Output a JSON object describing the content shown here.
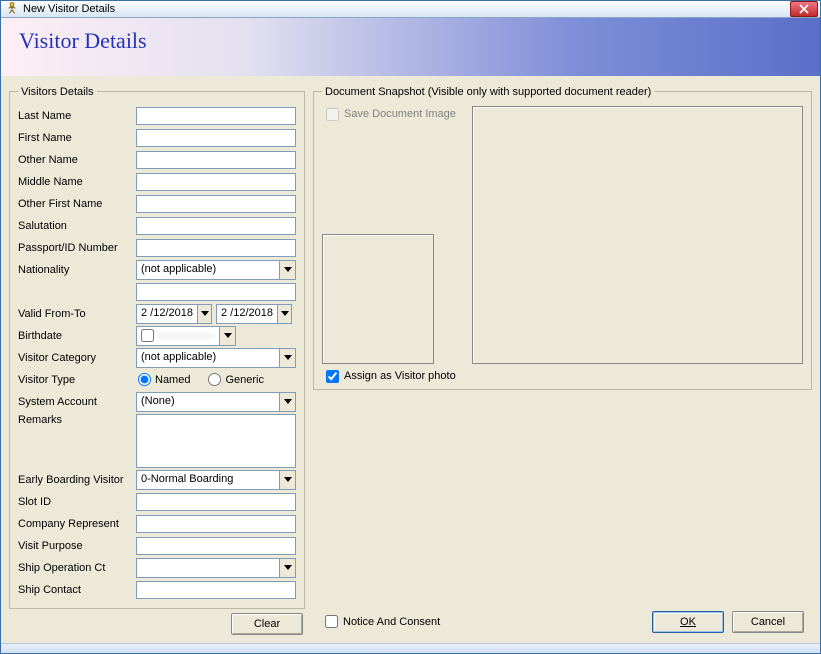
{
  "window": {
    "title": "New Visitor Details"
  },
  "header": {
    "title": "Visitor Details"
  },
  "visitorsDetails": {
    "legend": "Visitors Details",
    "labels": {
      "lastName": "Last Name",
      "firstName": "First Name",
      "otherName": "Other Name",
      "middleName": "Middle Name",
      "otherFirstName": "Other First Name",
      "salutation": "Salutation",
      "passportId": "Passport/ID Number",
      "nationality": "Nationality",
      "validFromTo": "Valid From-To",
      "birthdate": "Birthdate",
      "visitorCategory": "Visitor Category",
      "visitorType": "Visitor Type",
      "systemAccount": "System Account",
      "remarks": "Remarks",
      "earlyBoarding": "Early Boarding Visitor",
      "slotId": "Slot ID",
      "companyRepresent": "Company Represent",
      "visitPurpose": "Visit Purpose",
      "shipOperationCt": "Ship Operation Ct",
      "shipContact": "Ship Contact"
    },
    "values": {
      "lastName": "",
      "firstName": "",
      "otherName": "",
      "middleName": "",
      "otherFirstName": "",
      "salutation": "",
      "passportId": "",
      "nationality": "(not applicable)",
      "nationalityExtra": "",
      "validFrom": "2 /12/2018",
      "validTo": "2 /12/2018",
      "birthdate": " ",
      "visitorCategory": "(not applicable)",
      "visitorTypeOptions": {
        "named": "Named",
        "generic": "Generic"
      },
      "visitorTypeSelected": "named",
      "systemAccount": "(None)",
      "remarks": "",
      "earlyBoarding": "0-Normal Boarding",
      "slotId": "",
      "companyRepresent": "",
      "visitPurpose": "",
      "shipOperationCt": "",
      "shipContact": ""
    },
    "clearButton": "Clear"
  },
  "documentSnapshot": {
    "legend": "Document Snapshot (Visible only with supported document reader)",
    "saveImage": {
      "label": "Save Document Image",
      "checked": false
    },
    "assignPhoto": {
      "label": "Assign as Visitor photo",
      "checked": true
    }
  },
  "footer": {
    "notice": {
      "label": "Notice And Consent",
      "checked": false
    },
    "ok": "OK",
    "cancel": "Cancel"
  }
}
